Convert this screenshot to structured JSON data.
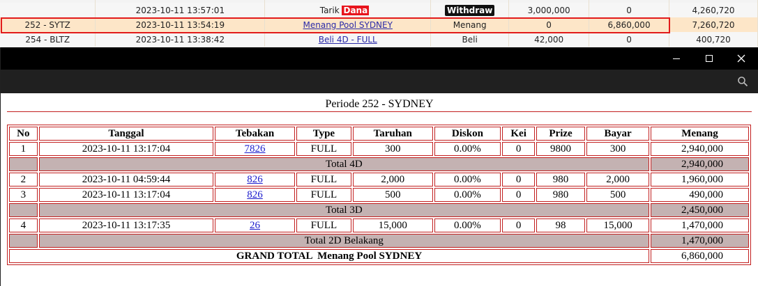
{
  "background": {
    "rows": [
      {
        "id": "",
        "date": "2023-10-11 13:57:01",
        "desc_prefix": "Tarik",
        "desc_badge": "Dana",
        "type": "Withdraw",
        "debit": "3,000,000",
        "credit": "0",
        "balance": "4,260,720"
      },
      {
        "id": "252 - SYTZ",
        "date": "2023-10-11 13:54:19",
        "desc": "Menang Pool SYDNEY",
        "type": "Menang",
        "debit": "0",
        "credit": "6,860,000",
        "balance": "7,260,720"
      },
      {
        "id": "254 - BLTZ",
        "date": "2023-10-11 13:38:42",
        "desc": "Beli 4D - FULL",
        "type": "Beli",
        "debit": "42,000",
        "credit": "0",
        "balance": "400,720"
      }
    ]
  },
  "modal": {
    "periode": "Periode 252 - SYDNEY",
    "headers": [
      "No",
      "Tanggal",
      "Tebakan",
      "Type",
      "Taruhan",
      "Diskon",
      "Kei",
      "Prize",
      "Bayar",
      "Menang"
    ],
    "rows": [
      {
        "no": "1",
        "tanggal": "2023-10-11 13:17:04",
        "tebakan": "7826",
        "type": "FULL",
        "taruhan": "300",
        "diskon": "0.00%",
        "kei": "0",
        "prize": "9800",
        "bayar": "300",
        "menang": "2,940,000"
      },
      {
        "no": "2",
        "tanggal": "2023-10-11 04:59:44",
        "tebakan": "826",
        "type": "FULL",
        "taruhan": "2,000",
        "diskon": "0.00%",
        "kei": "0",
        "prize": "980",
        "bayar": "2,000",
        "menang": "1,960,000"
      },
      {
        "no": "3",
        "tanggal": "2023-10-11 13:17:04",
        "tebakan": "826",
        "type": "FULL",
        "taruhan": "500",
        "diskon": "0.00%",
        "kei": "0",
        "prize": "980",
        "bayar": "500",
        "menang": "490,000"
      },
      {
        "no": "4",
        "tanggal": "2023-10-11 13:17:35",
        "tebakan": "26",
        "type": "FULL",
        "taruhan": "15,000",
        "diskon": "0.00%",
        "kei": "0",
        "prize": "98",
        "bayar": "15,000",
        "menang": "1,470,000"
      }
    ],
    "totals": {
      "t4d_label": "Total 4D",
      "t4d_value": "2,940,000",
      "t3d_label": "Total 3D",
      "t3d_value": "2,450,000",
      "t2d_label": "Total 2D Belakang",
      "t2d_value": "1,470,000"
    },
    "grand_label": "GRAND TOTAL  Menang Pool SYDNEY",
    "grand_value": "6,860,000"
  },
  "icons": {
    "minimize": "minimize-icon",
    "maximize": "maximize-icon",
    "close": "close-icon",
    "search": "search-icon"
  },
  "colors": {
    "highlight": "#e21b1b",
    "row_highlight": "#fde6c8",
    "total_row": "#c4b2b2",
    "border": "#c21f1f",
    "link": "#1a1acc"
  }
}
